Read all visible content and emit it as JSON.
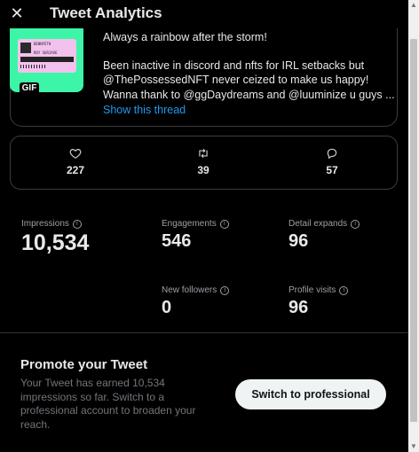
{
  "header": {
    "close_icon": "close-icon",
    "title": "Tweet Analytics"
  },
  "tweet": {
    "media": {
      "badge": "GIF",
      "ticket_line1": "BENNYETH",
      "ticket_line2": "ROY SURJAVE",
      "accent_color": "#3df5a7",
      "ticket_color": "#f3c1ee"
    },
    "lines": [
      "Always a rainbow after the storm!",
      "Been inactive in discord and nfts for IRL setbacks but",
      "@ThePossessedNFT never ceized to make us happy!",
      "Wanna thank to @ggDaydreams and @luuminize u guys ..."
    ],
    "show_thread": "Show this thread",
    "link_color": "#1d9bf0"
  },
  "engagement_row": {
    "likes": {
      "icon": "heart-icon",
      "value": "227"
    },
    "retweets": {
      "icon": "retweet-icon",
      "value": "39"
    },
    "replies": {
      "icon": "reply-icon",
      "value": "57"
    }
  },
  "stats": {
    "impressions": {
      "label": "Impressions",
      "value": "10,534"
    },
    "engagements": {
      "label": "Engagements",
      "value": "546"
    },
    "detail_expands": {
      "label": "Detail expands",
      "value": "96"
    },
    "new_followers": {
      "label": "New followers",
      "value": "0"
    },
    "profile_visits": {
      "label": "Profile visits",
      "value": "96"
    }
  },
  "promo": {
    "title": "Promote your Tweet",
    "lines": [
      "Your Tweet has earned 10,534",
      "impressions so far. Switch to a",
      "professional account to broaden your",
      "reach."
    ],
    "button_label": "Switch to professional"
  }
}
